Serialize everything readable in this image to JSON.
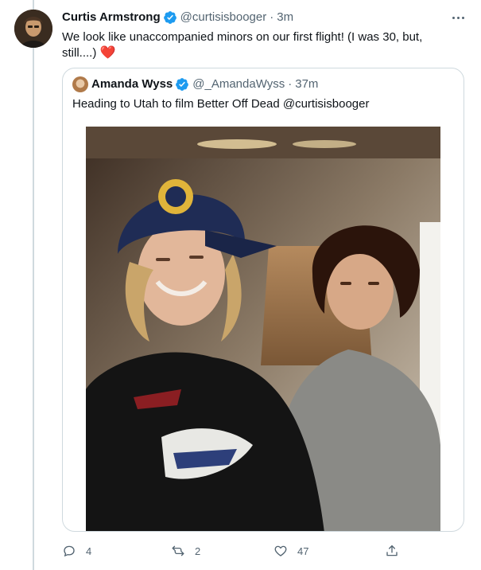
{
  "tweet": {
    "author": {
      "display_name": "Curtis Armstrong",
      "handle": "@curtisisbooger",
      "verified": true
    },
    "separator": "·",
    "timestamp": "3m",
    "text": "We look like unaccompanied minors on our first flight! (I was 30, but, still....)",
    "emoji": "❤️",
    "more_icon": "more-horizontal-icon"
  },
  "quoted_tweet": {
    "author": {
      "display_name": "Amanda Wyss",
      "handle": "@_AmandaWyss",
      "verified": true
    },
    "separator": "·",
    "timestamp": "37m",
    "text": "Heading to Utah to film Better Off Dead @curtisisbooger"
  },
  "actions": {
    "reply": {
      "icon": "reply-icon",
      "count": "4"
    },
    "retweet": {
      "icon": "retweet-icon",
      "count": "2"
    },
    "like": {
      "icon": "like-icon",
      "count": "47"
    },
    "share": {
      "icon": "share-icon"
    }
  },
  "colors": {
    "text_primary": "#0f1419",
    "text_secondary": "#536471",
    "verified_blue": "#1d9bf0",
    "border": "#cfd9de",
    "heart_red": "#e0245e"
  }
}
